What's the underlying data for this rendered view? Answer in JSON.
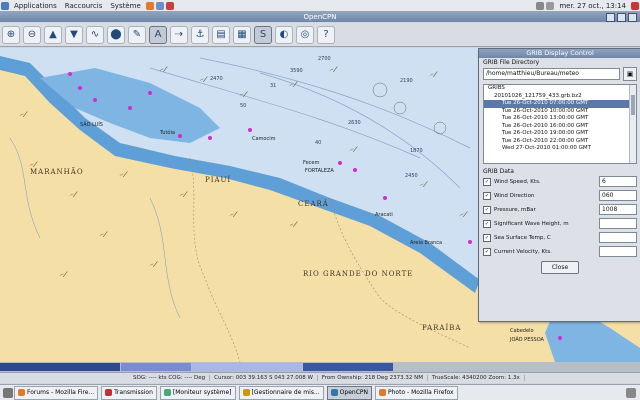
{
  "top_panel": {
    "applications": "Applications",
    "places": "Raccourcis",
    "system": "Système",
    "clock": "mer. 27 oct., 13:14"
  },
  "window": {
    "title": "OpenCPN"
  },
  "map": {
    "regions": [
      "MARANHÃO",
      "PIAUÍ",
      "CEARÁ",
      "RIO GRANDE DO NORTE",
      "PARAÍBA"
    ],
    "cities": [
      "SÃO LUÍS",
      "Tutóia",
      "Camocim",
      "Fecem",
      "FORTALEZA",
      "Aracati",
      "Areia Branca",
      "Cabedelo",
      "JOÃO PESSOA"
    ],
    "depths": [
      "2470",
      "3590",
      "2700",
      "2190",
      "2630",
      "1870",
      "2450",
      "31",
      "50",
      "40"
    ]
  },
  "grib": {
    "title": "GRIB Display Control",
    "dir_label": "GRIB File Directory",
    "path": "/home/matthieu/Bureau/meteo",
    "tree": [
      "GRIBS",
      "20101026_121759_433.grb.bz2",
      "Tue 26-Oct-2010 07:00:00 GMT",
      "Tue 26-Oct-2010 10:00:00 GMT",
      "Tue 26-Oct-2010 13:00:00 GMT",
      "Tue 26-Oct-2010 16:00:00 GMT",
      "Tue 26-Oct-2010 19:00:00 GMT",
      "Tue 26-Oct-2010 22:00:00 GMT",
      "Wed 27-Oct-2010 01:00:00 GMT"
    ],
    "data_label": "GRIB Data",
    "rows": [
      {
        "label": "Wind Speed, Kts.",
        "value": "6",
        "checked": true
      },
      {
        "label": "Wind Direction",
        "value": "060",
        "checked": true
      },
      {
        "label": "Pressure, mBar",
        "value": "1008",
        "checked": true
      },
      {
        "label": "Significant Wave Height, m",
        "value": "",
        "checked": true
      },
      {
        "label": "Sea Surface Temp, C",
        "value": "",
        "checked": true
      },
      {
        "label": "Current Velocity, Kts.",
        "value": "",
        "checked": true
      }
    ],
    "close_label": "Close"
  },
  "status": {
    "sog": "SOG: ---- kts  COG: ---- Deg",
    "cursor": "Cursor: 003 39.163 S 043 27.008 W",
    "from_ownship": "From Ownship: 218 Deg  2373.32 NM",
    "scale": "TrueScale: 4340200  Zoom: 1.3x"
  },
  "taskbar": [
    {
      "label": "Forums - Mozilla Fire..."
    },
    {
      "label": "Transmission"
    },
    {
      "label": "[Moniteur système]"
    },
    {
      "label": "[Gestionnaire de mis..."
    },
    {
      "label": "OpenCPN"
    },
    {
      "label": "Photo - Mozilla Firefox"
    }
  ]
}
